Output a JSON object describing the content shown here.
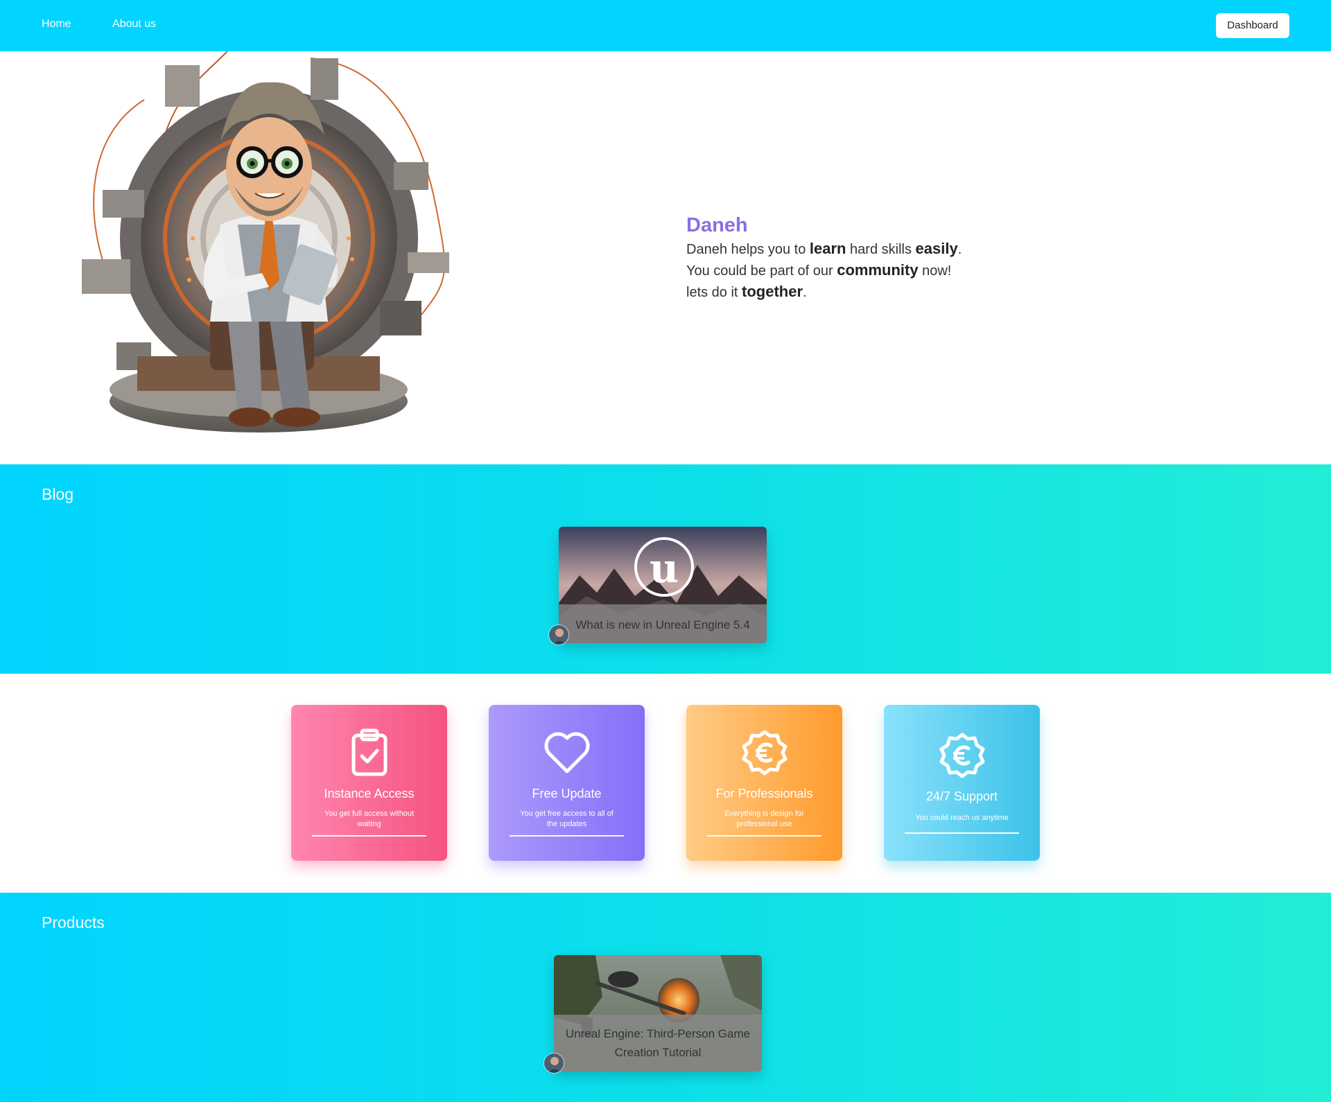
{
  "nav": {
    "home": "Home",
    "about": "About us",
    "dashboard": "Dashboard"
  },
  "hero": {
    "brand": "Daneh",
    "line1": {
      "a": "Daneh helps you to ",
      "b": "learn",
      "c": " hard skills ",
      "d": "easily",
      "e": "."
    },
    "line2": {
      "a": "You could be part of our ",
      "b": "community",
      "c": " now!"
    },
    "line3": {
      "a": "lets do it ",
      "b": "together",
      "c": "."
    }
  },
  "blog": {
    "title": "Blog",
    "posts": [
      {
        "title": "What is new in Unreal Engine 5.4",
        "image_icon": "unreal-engine-logo"
      }
    ]
  },
  "features": [
    {
      "title": "Instance Access",
      "desc": "You get full access without waiting",
      "icon": "clipboard-check-icon",
      "colors": [
        "#ff86b0",
        "#f5537f"
      ]
    },
    {
      "title": "Free Update",
      "desc": "You get free access to all of the updates",
      "icon": "heart-icon",
      "colors": [
        "#ad9afc",
        "#8470f7"
      ]
    },
    {
      "title": "For Professionals",
      "desc": "Everything is design for professional use",
      "icon": "euro-badge-icon",
      "colors": [
        "#ffcb85",
        "#ff9a2c"
      ]
    },
    {
      "title": "24/7 Support",
      "desc": "You could reach us anytime",
      "icon": "euro-badge-icon",
      "colors": [
        "#8ae1fb",
        "#3cc2e8"
      ]
    }
  ],
  "products": {
    "title": "Products",
    "items": [
      {
        "title": "Unreal Engine: Third-Person Game Creation Tutorial"
      }
    ]
  },
  "colors": {
    "nav": "#00d4ff",
    "brand": "#8a6fe0",
    "gradient_start": "#00d4ff",
    "gradient_end": "#22edd6"
  }
}
